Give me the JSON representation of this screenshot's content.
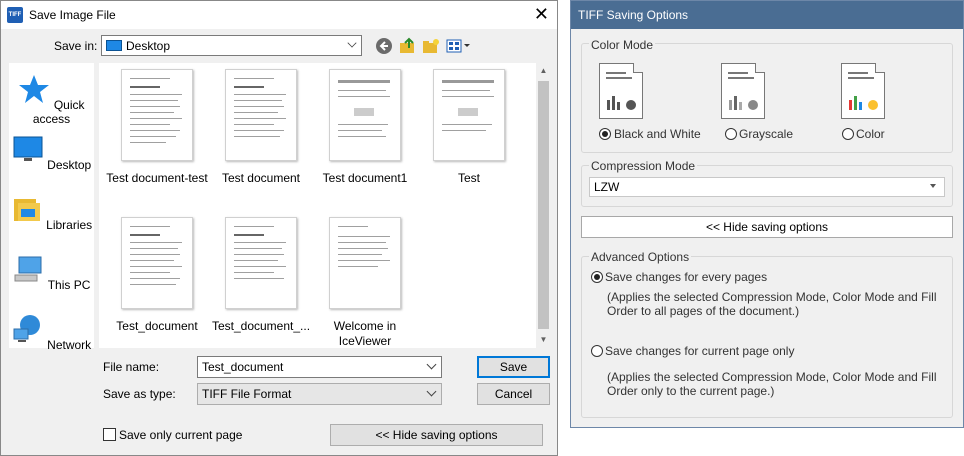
{
  "dialog": {
    "title": "Save Image File",
    "app_icon_text": "TIFF",
    "close_symbol": "✕",
    "save_in_label": "Save in:",
    "save_in_value": "Desktop",
    "places": [
      {
        "label": "Quick access",
        "icon": "star-icon"
      },
      {
        "label": "Desktop",
        "icon": "desktop-icon"
      },
      {
        "label": "Libraries",
        "icon": "libraries-icon"
      },
      {
        "label": "This PC",
        "icon": "computer-icon"
      },
      {
        "label": "Network",
        "icon": "network-icon"
      }
    ],
    "files": [
      {
        "name": "Test document-test"
      },
      {
        "name": "Test document"
      },
      {
        "name": "Test document1"
      },
      {
        "name": "Test"
      },
      {
        "name": "Test_document"
      },
      {
        "name": "Test_document_..."
      },
      {
        "name": "Welcome in IceViewer"
      }
    ],
    "file_name_label": "File name:",
    "file_name_value": "Test_document",
    "save_as_type_label": "Save as type:",
    "save_as_type_value": "TIFF File Format",
    "save_button": "Save",
    "cancel_button": "Cancel",
    "save_only_current_page": "Save only current page",
    "hide_options_button": "<< Hide saving options"
  },
  "panel": {
    "title": "TIFF Saving Options",
    "color_mode_title": "Color Mode",
    "color_modes": [
      {
        "label": "Black and White",
        "selected": true
      },
      {
        "label": "Grayscale",
        "selected": false
      },
      {
        "label": "Color",
        "selected": false
      }
    ],
    "compression_title": "Compression Mode",
    "compression_value": "LZW",
    "hide_options_button": "<< Hide saving options",
    "advanced_title": "Advanced Options",
    "opt_every_pages": "Save changes for every pages",
    "opt_every_pages_desc": "(Applies the selected Compression Mode, Color Mode and Fill Order to all pages of the document.)",
    "opt_current_page": "Save changes for current page only",
    "opt_current_page_desc": "(Applies the selected Compression Mode, Color Mode and Fill Order only to the current page.)"
  },
  "colors": {
    "panel_header": "#4a6d93",
    "accent": "#0078d7"
  }
}
